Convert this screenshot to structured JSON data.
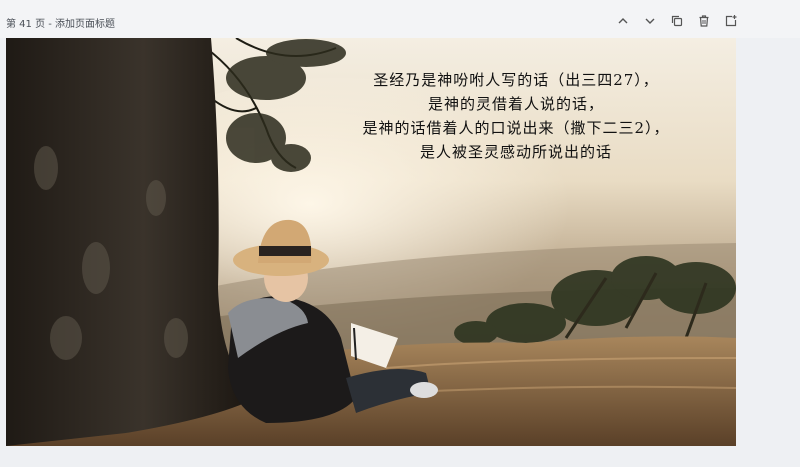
{
  "header": {
    "page_label": "第 41 页 - 添加页面标题"
  },
  "toolbar": {
    "icons": [
      "chevron-up-icon",
      "chevron-down-icon",
      "copy-icon",
      "trash-icon",
      "add-page-icon"
    ]
  },
  "slide": {
    "quote_lines": [
      "圣经乃是神吩咐人写的话（出三四27），",
      "是神的灵借着人说的话，",
      "是神的话借着人的口说出来（撒下二三2），",
      "是人被圣灵感动所说出的话"
    ]
  },
  "colors": {
    "background": "#eef0f3",
    "quote_text": "#111111"
  }
}
